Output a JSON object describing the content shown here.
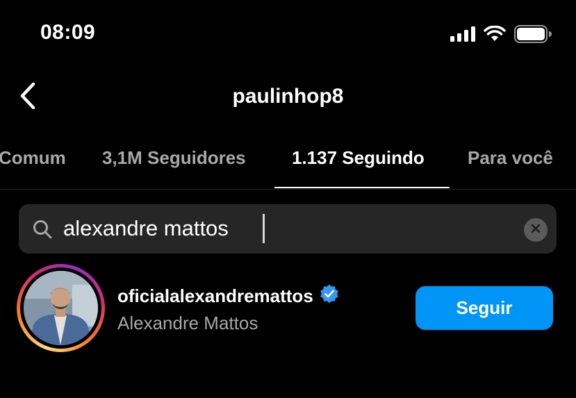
{
  "status_bar": {
    "time": "08:09",
    "icons": [
      "signal-icon",
      "wifi-icon",
      "battery-icon"
    ]
  },
  "header": {
    "title": "paulinhop8",
    "back_icon": "chevron-left-icon"
  },
  "tabs": [
    {
      "label": "Comum",
      "active": false
    },
    {
      "label": "3,1M Seguidores",
      "active": false
    },
    {
      "label": "1.137 Seguindo",
      "active": true
    },
    {
      "label": "Para você",
      "active": false
    }
  ],
  "search": {
    "value": "alexandre mattos",
    "icon": "search-icon",
    "clear_icon": "clear-icon"
  },
  "results": [
    {
      "username": "oficialalexandremattos",
      "verified": true,
      "full_name": "Alexandre Mattos",
      "follow_label": "Seguir"
    }
  ],
  "colors": {
    "accent": "#0095f6",
    "verified": "#3897f0",
    "background": "#000000",
    "secondary_text": "#a8a8a8",
    "search_bg": "#262626"
  }
}
